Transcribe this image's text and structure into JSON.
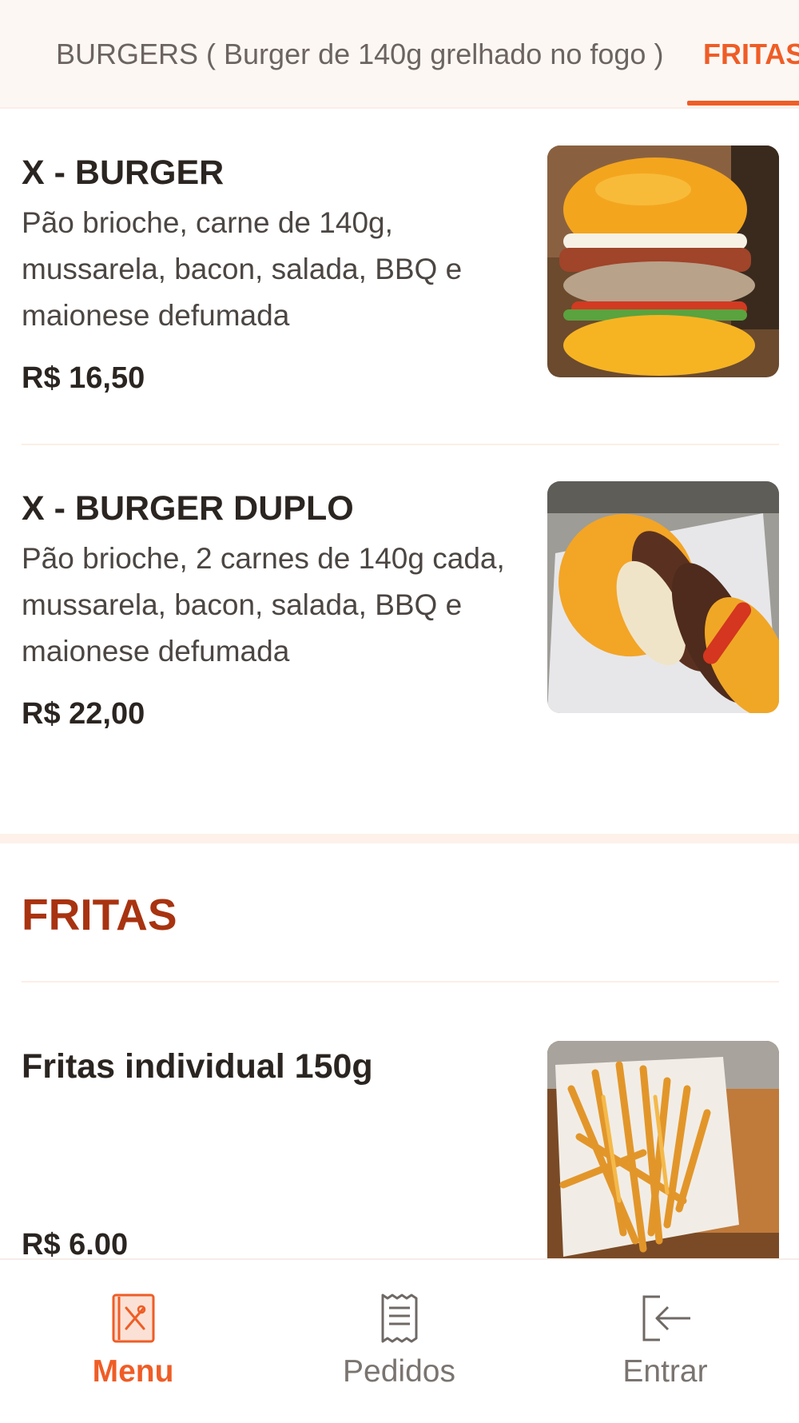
{
  "tabs": {
    "items": [
      {
        "label": "BURGERS ( Burger de 140g grelhado no fogo )",
        "active": false
      },
      {
        "label": "FRITAS",
        "active": true
      }
    ]
  },
  "items": [
    {
      "name": "X - BURGER",
      "description": "Pão brioche, carne de 140g, mussarela, bacon, salada, BBQ e maionese defumada",
      "price": "R$ 16,50",
      "image": "burger-photo"
    },
    {
      "name": "X - BURGER DUPLO",
      "description": "Pão brioche, 2 carnes de 140g cada, mussarela, bacon, salada, BBQ e maionese defumada",
      "price": "R$ 22,00",
      "image": "double-burger-photo"
    }
  ],
  "section": {
    "title": "FRITAS"
  },
  "fries_item": {
    "name": "Fritas individual 150g",
    "price": "R$ 6.00",
    "image": "fries-photo"
  },
  "bottom_nav": {
    "items": [
      {
        "label": "Menu",
        "icon": "menu-book-icon",
        "active": true
      },
      {
        "label": "Pedidos",
        "icon": "receipt-icon",
        "active": false
      },
      {
        "label": "Entrar",
        "icon": "login-icon",
        "active": false
      }
    ]
  },
  "colors": {
    "accent": "#ef5d26",
    "section_title": "#a83310",
    "tab_background": "#fdf7f4"
  }
}
